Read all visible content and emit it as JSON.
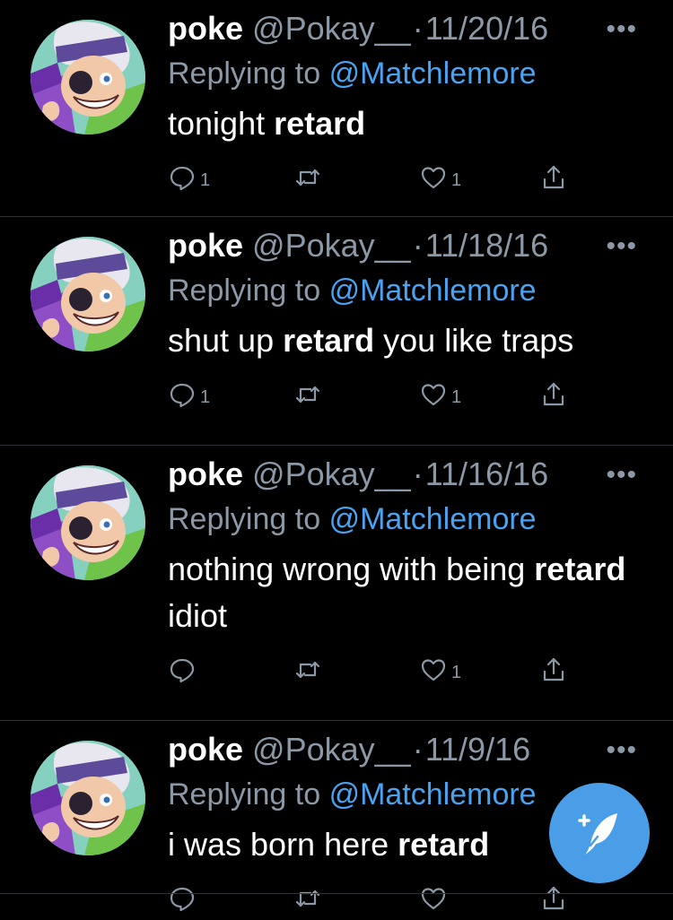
{
  "tweets": [
    {
      "name": "poke",
      "handle": "@Pokay__",
      "date": "11/20/16",
      "replying_label": "Replying to",
      "replying_to": "@Matchlemore",
      "segments": [
        {
          "text": "tonight ",
          "bold": false
        },
        {
          "text": "retard",
          "bold": true
        }
      ],
      "reply_count": "1",
      "retweet_count": "",
      "like_count": "1"
    },
    {
      "name": "poke",
      "handle": "@Pokay__",
      "date": "11/18/16",
      "replying_label": "Replying to",
      "replying_to": "@Matchlemore",
      "segments": [
        {
          "text": "shut up ",
          "bold": false
        },
        {
          "text": "retard",
          "bold": true
        },
        {
          "text": " you like traps",
          "bold": false
        }
      ],
      "reply_count": "1",
      "retweet_count": "",
      "like_count": "1"
    },
    {
      "name": "poke",
      "handle": "@Pokay__",
      "date": "11/16/16",
      "replying_label": "Replying to",
      "replying_to": "@Matchlemore",
      "segments": [
        {
          "text": "nothing wrong with being ",
          "bold": false
        },
        {
          "text": "retard",
          "bold": true
        },
        {
          "text": " idiot",
          "bold": false
        }
      ],
      "reply_count": "",
      "retweet_count": "",
      "like_count": "1"
    },
    {
      "name": "poke",
      "handle": "@Pokay__",
      "date": "11/9/16",
      "replying_label": "Replying to",
      "replying_to": "@Matchlemore",
      "segments": [
        {
          "text": "i was born here ",
          "bold": false
        },
        {
          "text": "retard",
          "bold": true
        }
      ],
      "reply_count": "",
      "retweet_count": "",
      "like_count": ""
    }
  ],
  "icons": {
    "more": "more-icon",
    "reply": "reply-icon",
    "retweet": "retweet-icon",
    "like": "heart-icon",
    "share": "share-icon",
    "compose": "compose-tweet-icon"
  },
  "colors": {
    "background": "#000000",
    "muted": "#8b98a5",
    "accent": "#4aa3f0",
    "fab": "#4a9ee8",
    "divider": "#2f3336"
  }
}
